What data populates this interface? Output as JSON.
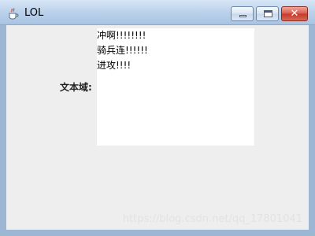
{
  "window": {
    "title": "LOL",
    "icon": "java-cup-icon",
    "controls": {
      "minimize": "minimize-icon",
      "maximize": "maximize-icon",
      "close": "close-icon"
    }
  },
  "form": {
    "label": "文本域:",
    "textarea_lines": [
      "冲啊!!!!!!!!",
      "骑兵连!!!!!!",
      "进攻!!!!"
    ]
  },
  "watermark": "https://blog.csdn.net/qq_17801041",
  "colors": {
    "title_bar": "#b9d0ea",
    "close_button": "#c2382a",
    "content_background": "#eeeeee",
    "textarea_background": "#ffffff"
  }
}
